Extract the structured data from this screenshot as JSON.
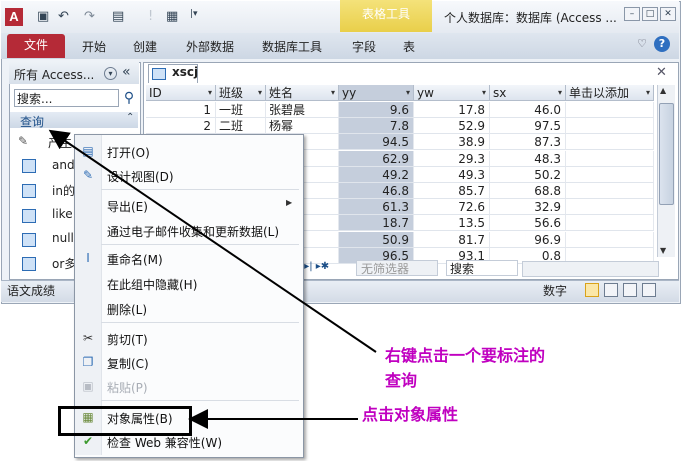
{
  "titlebar": {
    "app_icon": "A",
    "tool_tab": "表格工具",
    "window_title": "个人数据库：数据库 (Access ...",
    "quick_access": [
      "save-icon",
      "undo-icon",
      "redo-icon",
      "view-icon",
      "help-qat-icon",
      "table-qat-icon",
      "customize-icon"
    ]
  },
  "ribbon": {
    "file_tab": "文件",
    "tabs": [
      "开始",
      "创建",
      "外部数据",
      "数据库工具",
      "字段",
      "表"
    ],
    "help_icon": "?",
    "minimize_icon": "♡"
  },
  "nav_pane": {
    "header": "所有 Access...",
    "search_placeholder": "搜索...",
    "group": "查询",
    "items": [
      "产生",
      "and",
      "in的",
      "like",
      "null",
      "or多"
    ]
  },
  "table": {
    "doc_tab": "xscj",
    "columns": [
      "ID",
      "班级",
      "姓名",
      "yy",
      "yw",
      "sx",
      "单击以添加"
    ],
    "rows": [
      [
        "1",
        "一班",
        "张碧晨",
        "9.6",
        "17.8",
        "46.0"
      ],
      [
        "2",
        "二班",
        "杨幂",
        "7.8",
        "52.9",
        "97.5"
      ],
      [
        "",
        "",
        "",
        "94.5",
        "38.9",
        "87.3"
      ],
      [
        "",
        "",
        "",
        "62.9",
        "29.3",
        "48.3"
      ],
      [
        "",
        "",
        "",
        "49.2",
        "49.3",
        "50.2"
      ],
      [
        "",
        "",
        "",
        "46.8",
        "85.7",
        "68.8"
      ],
      [
        "",
        "",
        "",
        "61.3",
        "72.6",
        "32.9"
      ],
      [
        "",
        "",
        "",
        "18.7",
        "13.5",
        "56.6"
      ],
      [
        "",
        "",
        "",
        "50.9",
        "81.7",
        "96.9"
      ],
      [
        "",
        "",
        "",
        "96.5",
        "93.1",
        "0.8"
      ]
    ],
    "no_filter": "无筛选器",
    "search": "搜索"
  },
  "statusbar": {
    "left": "语文成绩",
    "right": "数字"
  },
  "context_menu": {
    "items": [
      {
        "label": "打开(O)",
        "icon": "open-icon",
        "disabled": false
      },
      {
        "label": "设计视图(D)",
        "icon": "design-view-icon",
        "disabled": false
      },
      {
        "label": "导出(E)",
        "icon": "",
        "disabled": false,
        "submenu": true
      },
      {
        "label": "通过电子邮件收集和更新数据(L)",
        "icon": "",
        "disabled": false
      },
      {
        "label": "重命名(M)",
        "icon": "rename-icon",
        "disabled": false
      },
      {
        "label": "在此组中隐藏(H)",
        "icon": "",
        "disabled": false
      },
      {
        "label": "删除(L)",
        "icon": "",
        "disabled": false
      },
      {
        "label": "剪切(T)",
        "icon": "cut-icon",
        "disabled": false
      },
      {
        "label": "复制(C)",
        "icon": "copy-icon",
        "disabled": false
      },
      {
        "label": "粘贴(P)",
        "icon": "paste-icon",
        "disabled": true
      },
      {
        "label": "对象属性(B)",
        "icon": "properties-icon",
        "disabled": false
      },
      {
        "label": "检查 Web 兼容性(W)",
        "icon": "web-check-icon",
        "disabled": false
      }
    ]
  },
  "annotations": {
    "note1_line1": "右键点击一个要标注的",
    "note1_line2": "查询",
    "note2": "点击对象属性",
    "color": "#c000c0"
  }
}
